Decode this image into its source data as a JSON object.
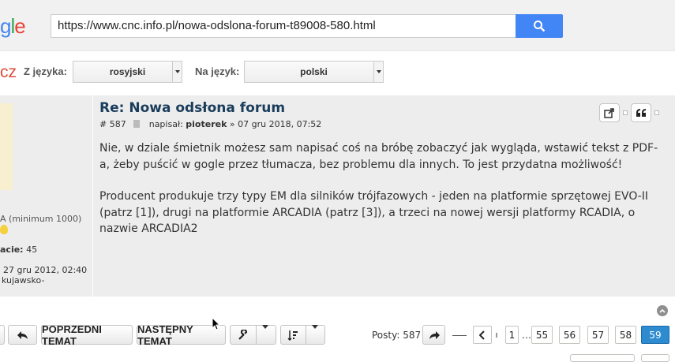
{
  "translate_bar": {
    "logo": {
      "p1": "g",
      "p2": "l",
      "p3": "e"
    },
    "url_value": "https://www.cnc.info.pl/nowa-odslona-forum-t89008-580.html",
    "search_icon": "search-icon",
    "accent_color": "#4285f4"
  },
  "language_bar": {
    "cz": "cz",
    "from_label": "Z języka:",
    "from_value": "rosyjski",
    "to_label": "Na język:",
    "to_value": "polski"
  },
  "profile": {
    "rank": "A (minimum 1000)",
    "posts_label": "acie:",
    "posts_value": "45",
    "joined": "27 gru 2012, 02:40",
    "location": "kujawsko-"
  },
  "post": {
    "title": "Re: Nowa odsłona forum",
    "number": "# 587",
    "author_prefix": "napisał:",
    "author": "pioterek",
    "date": "» 07 gru 2018, 07:52",
    "paragraphs": [
      "Nie, w dziale śmietnik możesz sam napisać coś na bróbę zobaczyć jak wygląda, wstawić tekst z PDF-a, żeby puścić w gogle przez tłumacza, bez problemu dla innych. To jest przydatna możliwość!",
      "Producent produkuje trzy typy EM dla silników trójfazowych - jeden na platformie sprzętowej EVO-II (patrz [1]), drugi na platformie ARCADIA (patrz [3]), a trzeci na nowej wersji platformy RCADIA, o nazwie ARCADIA2"
    ]
  },
  "actions": {
    "prev_topic": "POPRZEDNI TEMAT",
    "next_topic": "NASTĘPNY TEMAT",
    "posts_count": "Posty: 587",
    "pages": [
      "1",
      "55",
      "56",
      "57",
      "58",
      "59"
    ],
    "ellipsis": "…",
    "current_page": "59"
  }
}
